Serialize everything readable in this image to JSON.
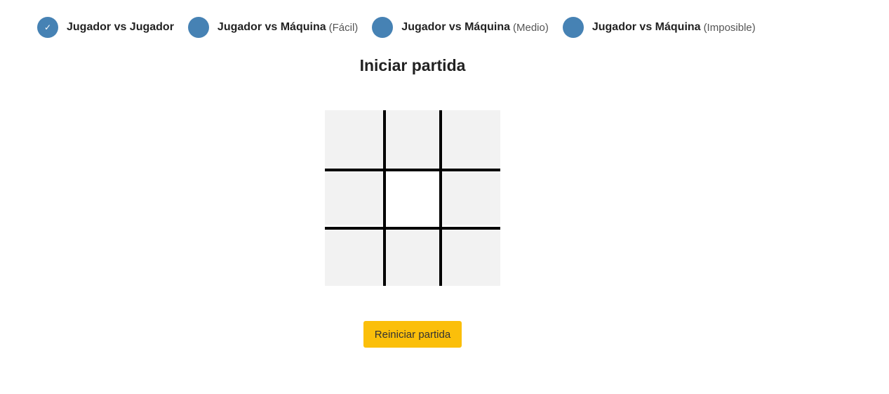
{
  "modes": [
    {
      "label": "Jugador vs Jugador",
      "level": "",
      "selected": true
    },
    {
      "label": "Jugador vs Máquina",
      "level": "(Fácil)",
      "selected": false
    },
    {
      "label": "Jugador vs Máquina",
      "level": "(Medio)",
      "selected": false
    },
    {
      "label": "Jugador vs Máquina",
      "level": "(Imposible)",
      "selected": false
    }
  ],
  "check_glyph": "✓",
  "status": "Iniciar partida",
  "board": {
    "cells": [
      "",
      "",
      "",
      "",
      "",
      "",
      "",
      "",
      ""
    ]
  },
  "reset_label": "Reiniciar partida",
  "colors": {
    "radio": "#4682b4",
    "button": "#fbbf0a",
    "board_cell": "#f2f2f2",
    "grid_line": "#000000"
  }
}
